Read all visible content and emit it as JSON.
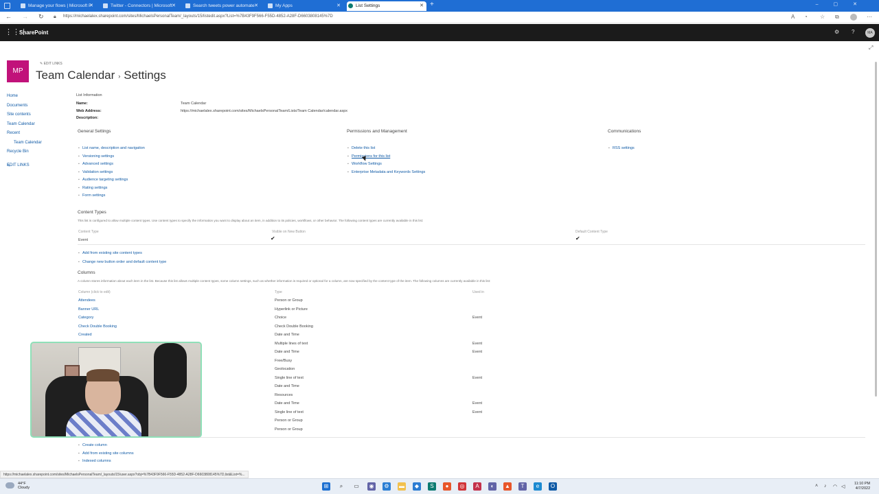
{
  "browser": {
    "tabs": [
      {
        "title": "Manage your flows | Microsoft P"
      },
      {
        "title": "Twitter - Connectors | Microsoft"
      },
      {
        "title": "Search tweets power automate"
      },
      {
        "title": "My Apps"
      },
      {
        "title": "List Settings"
      }
    ],
    "url": "https://michaelalex.sharepoint.com/sites/MichaelsPersonalTeam/_layouts/15/listedit.aspx?List=%7B43F9F566-F55D-4852-A28F-D6603808145%7D"
  },
  "suite": {
    "brand": "SharePoint",
    "user_initials": "MA"
  },
  "site": {
    "logo_text": "MP",
    "edit_links": "EDIT LINKS",
    "title_list": "Team Calendar",
    "title_sep": "›",
    "title_page": "Settings"
  },
  "quick_launch": {
    "items": [
      "Home",
      "Documents",
      "Site contents",
      "Team Calendar",
      "Recent",
      "Team Calendar",
      "Recycle Bin"
    ],
    "edit_links": "EDIT LINKS"
  },
  "list_info": {
    "heading": "List Information",
    "name_label": "Name:",
    "name_value": "Team Calendar",
    "web_label": "Web Address:",
    "web_value": "https://michaelalex.sharepoint.com/sites/MichaelsPersonalTeam/Lists/Team Calendar/calendar.aspx",
    "desc_label": "Description:"
  },
  "general_settings": {
    "heading": "General Settings",
    "links": [
      "List name, description and navigation",
      "Versioning settings",
      "Advanced settings",
      "Validation settings",
      "Audience targeting settings",
      "Rating settings",
      "Form settings"
    ]
  },
  "permissions": {
    "heading": "Permissions and Management",
    "links": [
      "Delete this list",
      "Permissions for this list",
      "Workflow Settings",
      "Enterprise Metadata and Keywords Settings"
    ]
  },
  "communications": {
    "heading": "Communications",
    "links": [
      "RSS settings"
    ]
  },
  "content_types": {
    "heading": "Content Types",
    "description": "This list is configured to allow multiple content types. Use content types to specify the information you want to display about an item, in addition to its policies, workflows, or other behavior. The following content types are currently available in this list:",
    "col_content_type": "Content Type",
    "col_visible": "Visible on New Button",
    "col_default": "Default Content Type",
    "rows": [
      {
        "name": "Event",
        "visible": "✔",
        "default": "✔"
      }
    ],
    "links": [
      "Add from existing site content types",
      "Change new button order and default content type"
    ]
  },
  "columns": {
    "heading": "Columns",
    "description": "A column stores information about each item in the list. Because this list allows multiple content types, some column settings, such as whether information is required or optional for a column, are now specified by the content type of the item. The following columns are currently available in this list:",
    "col_name": "Column (click to edit)",
    "col_type": "Type",
    "col_used": "Used in",
    "names": [
      "Attendees",
      "Banner URL",
      "Category",
      "Check Double Booking",
      "Created"
    ],
    "types": [
      "Person or Group",
      "Hyperlink or Picture",
      "Choice",
      "Check Double Booking",
      "Date and Time",
      "Multiple lines of text",
      "Date and Time",
      "Free/Busy",
      "Geolocation",
      "Single line of text",
      "Date and Time",
      "Resources",
      "Date and Time",
      "Single line of text",
      "Person or Group",
      "Person or Group"
    ],
    "used": [
      "",
      "",
      "Event",
      "",
      "",
      "Event",
      "Event",
      "",
      "",
      "Event",
      "",
      "",
      "Event",
      "Event",
      "",
      ""
    ],
    "links": [
      "Create column",
      "Add from existing site columns",
      "Indexed columns"
    ]
  },
  "status_url": "https://michaelalex.sharepoint.com/sites/MichaelsPersonalTeam/_layouts/15/user.aspx?obj=%7B43F9F566-F55D-4852-A28F-D6603808145%7D,list&List=%...",
  "taskbar": {
    "temperature": "44°F",
    "weather": "Cloudy",
    "time": "11:10 PM",
    "date": "4/7/2022"
  }
}
